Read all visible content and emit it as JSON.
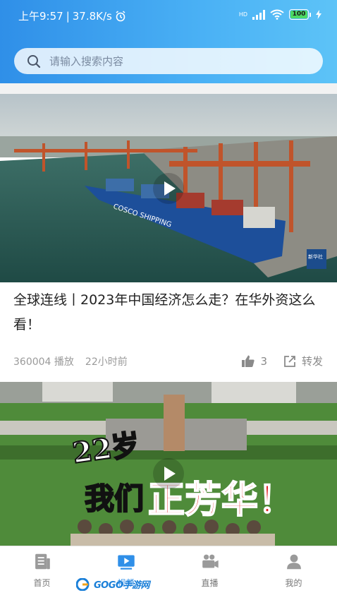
{
  "status_bar": {
    "time": "上午9:57",
    "separator": "|",
    "net_speed": "37.8K/s",
    "battery": "100",
    "hd_label": "HD"
  },
  "search": {
    "placeholder": "请输入搜索内容",
    "icon": "search-icon"
  },
  "feed": [
    {
      "title": "全球连线丨2023年中国经济怎么走？在华外资这么看！",
      "plays": "360004 播放",
      "time_ago": "22小时前",
      "likes": "3",
      "share_label": "转发",
      "thumb_caption": "COSCO SHIPPING",
      "thumb_badge": "新华社"
    },
    {
      "overlay_line1": "22岁",
      "overlay_line2": "我们",
      "overlay_line3": "正芳华！"
    }
  ],
  "tabbar": [
    {
      "label": "首页",
      "icon": "news-icon",
      "active": false
    },
    {
      "label": "视频",
      "icon": "video-icon",
      "active": true
    },
    {
      "label": "直播",
      "icon": "camera-icon",
      "active": false
    },
    {
      "label": "我的",
      "icon": "user-icon",
      "active": false
    }
  ],
  "watermark": {
    "text": "GOGO手游网"
  },
  "colors": {
    "accent": "#2f8fe8",
    "header_light": "#5dc3f7",
    "battery_green": "#4cd964"
  }
}
